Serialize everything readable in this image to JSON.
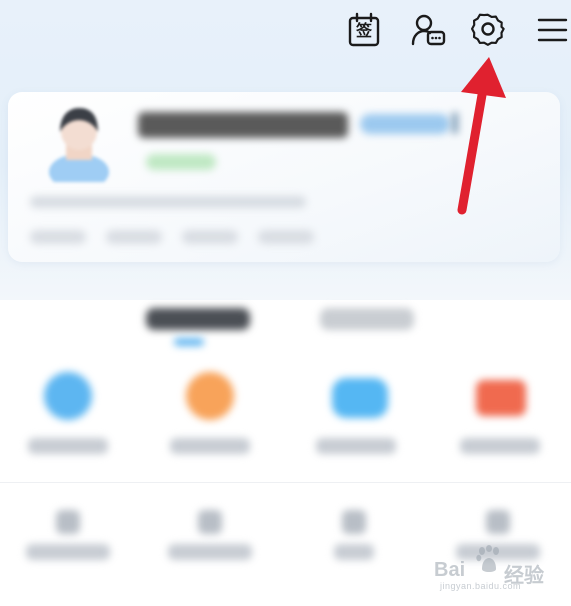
{
  "topbar": {
    "sign_char": "签",
    "icons": [
      "calendar-sign-icon",
      "customer-service-icon",
      "settings-gear-icon",
      "hamburger-menu-icon"
    ]
  },
  "annotation": {
    "arrow_color": "#e0212f",
    "points_to": "settings-gear-icon"
  },
  "colors": {
    "accent_blue": "#63b6f0",
    "grid_icon_1": "#5db6f1",
    "grid_icon_2": "#f8a35a",
    "grid_icon_3": "#55b7f3",
    "grid_icon_4": "#f06a4f"
  },
  "watermark": {
    "logo_left": "Bai",
    "logo_right": "经验",
    "url": "jingyan.baidu.com"
  }
}
